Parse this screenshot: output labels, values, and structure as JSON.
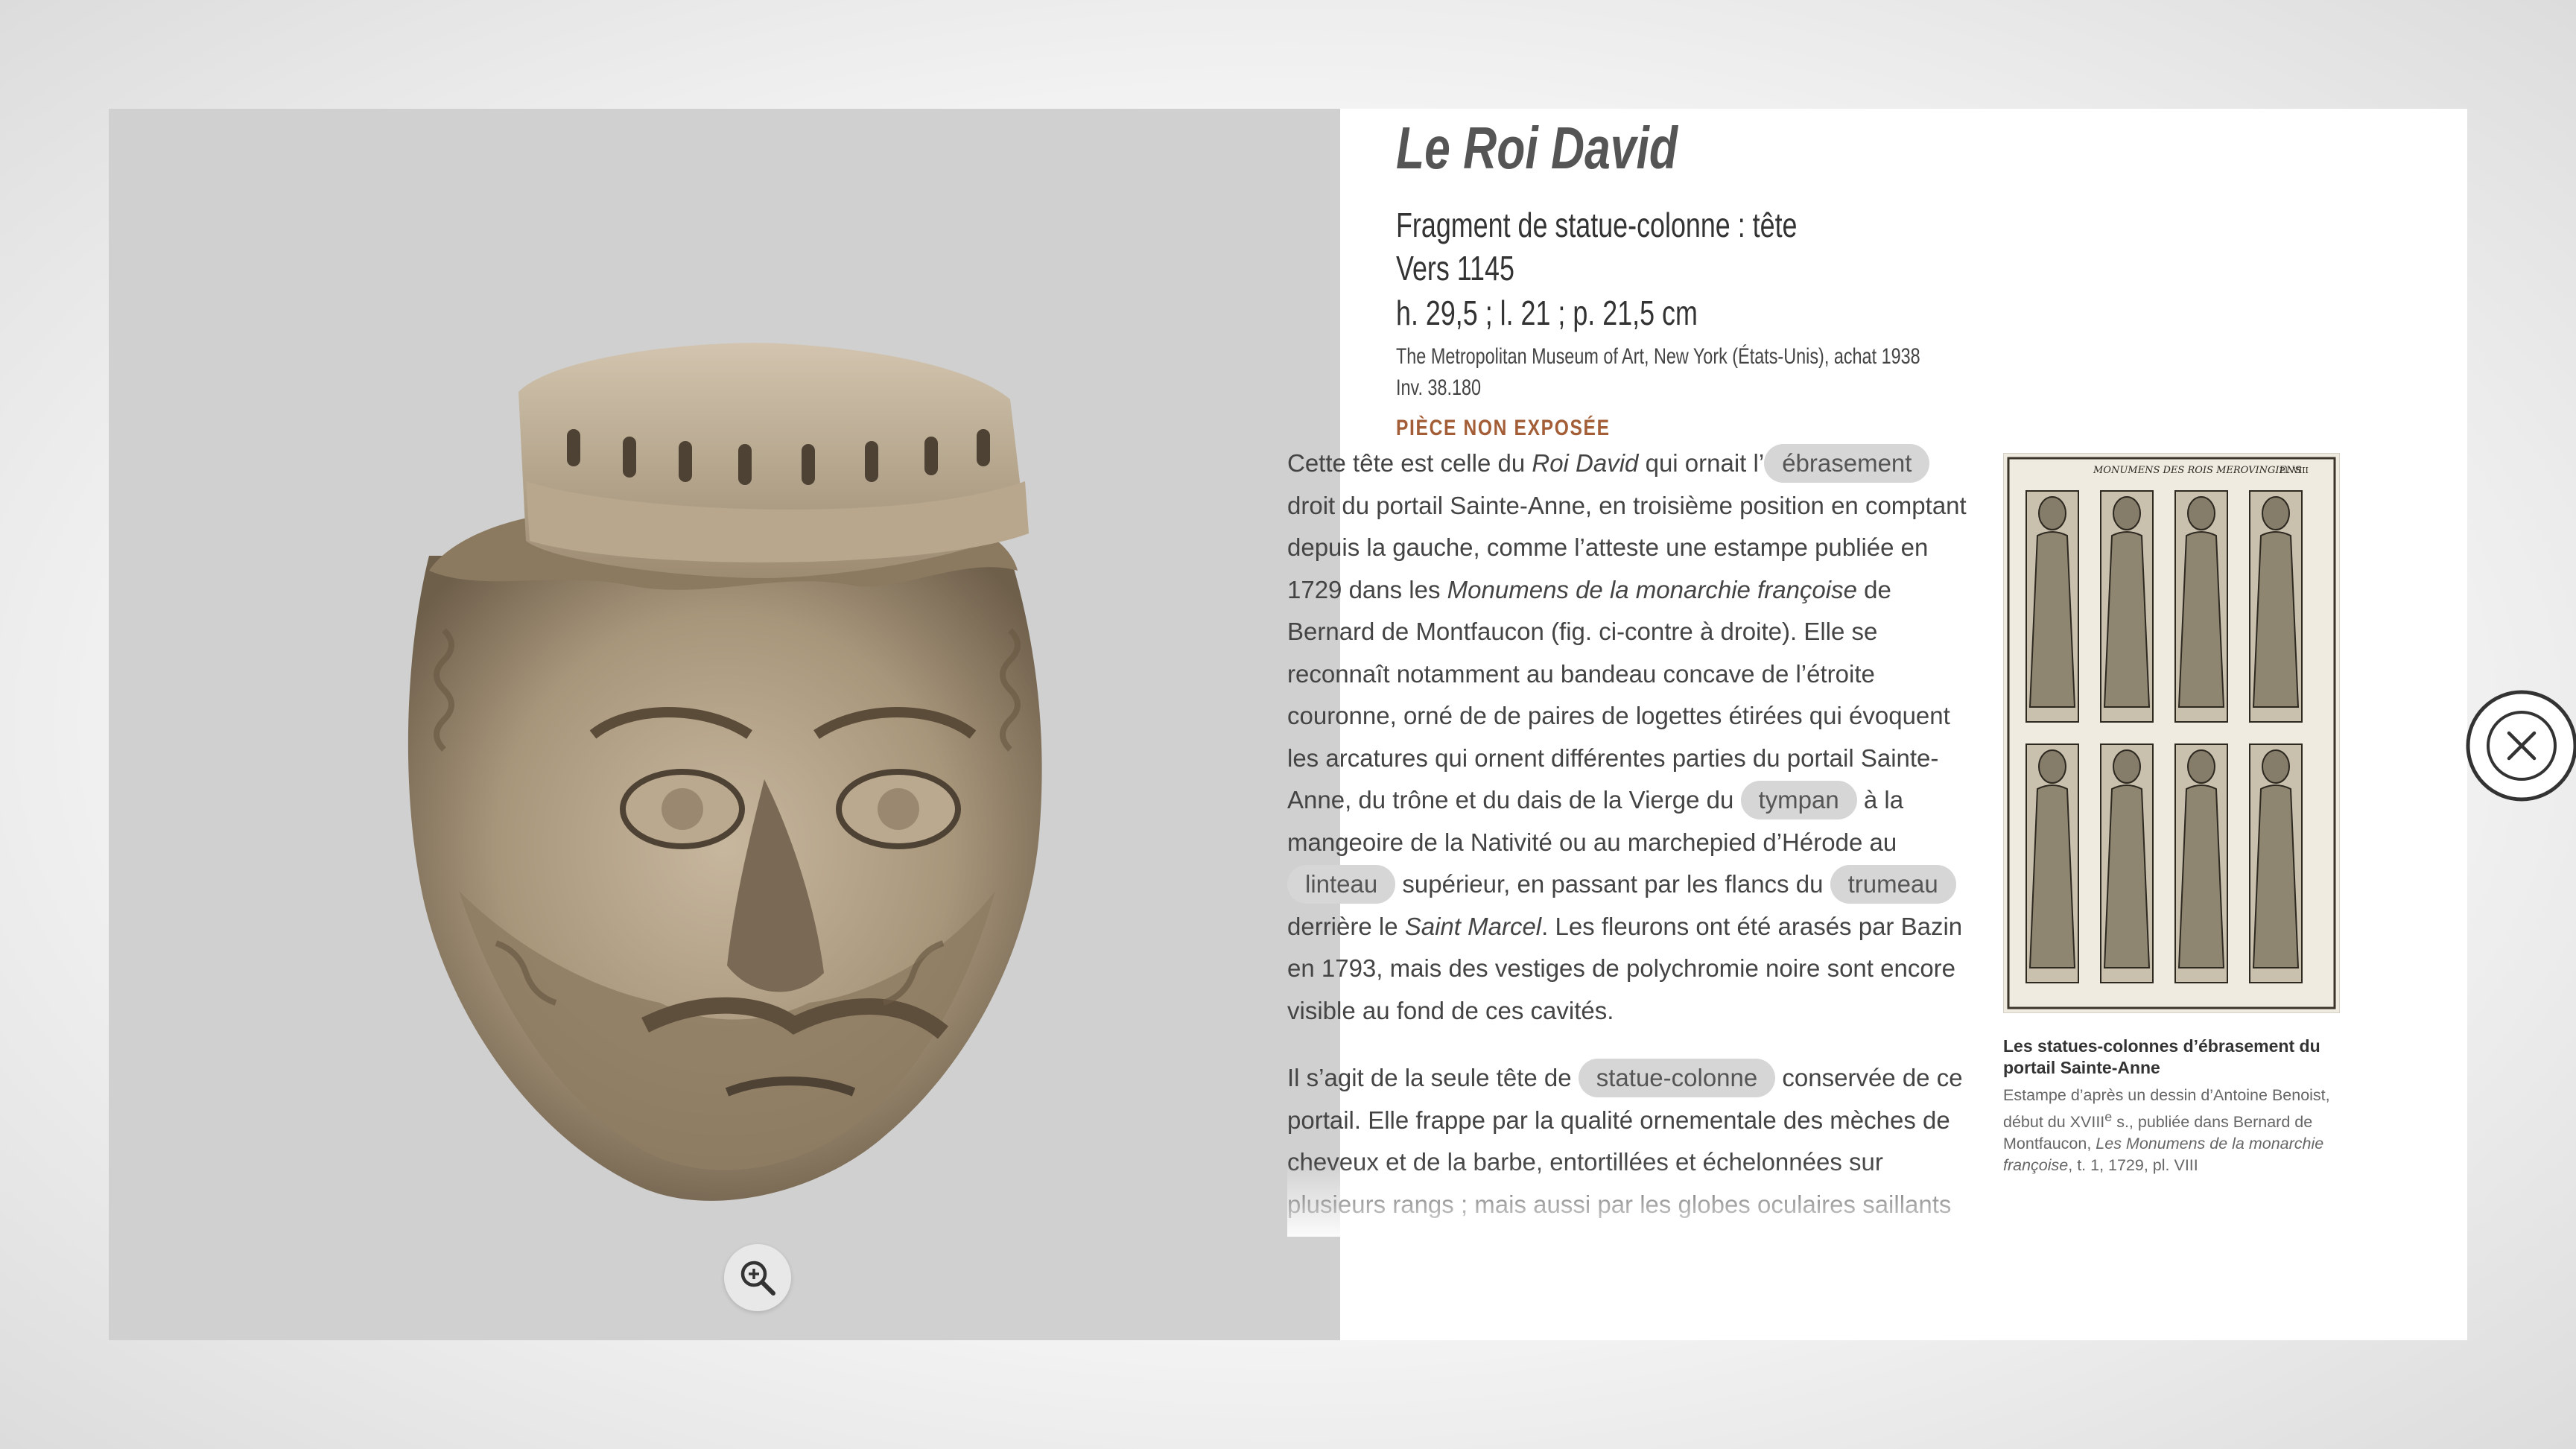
{
  "artwork": {
    "title": "Le Roi David",
    "type": "Fragment de statue-colonne : tête",
    "date": "Vers 1145",
    "dimensions": "h. 29,5 ; l. 21 ; p. 21,5 cm",
    "location": "The Metropolitan Museum of Art, New York (États-Unis), achat 1938",
    "inventory": "Inv. 38.180",
    "status": "PIÈCE NON EXPOSÉE"
  },
  "image": {
    "icon": "sculpture-head-image",
    "zoom_icon": "zoom-in-icon"
  },
  "description": {
    "p1": {
      "t1": "Cette tête est celle du ",
      "em1": "Roi David",
      "t2": " qui ornait l’",
      "pill1": "ébrasement",
      "t3": " droit du portail Sainte-Anne, en troisième position en comptant depuis la gauche, comme l’atteste une estampe publiée en 1729 dans les ",
      "em2": "Monumens de la monarchie françoise",
      "t4": " de Bernard de Montfaucon (fig. ci-contre à droite). Elle se reconnaît notamment au bandeau concave de l’étroite couronne, orné de de paires de logettes étirées qui évoquent les arcatures qui ornent différentes parties du portail Sainte-Anne, du trône et du dais de la Vierge du ",
      "pill2": "tympan",
      "t5": " à la mangeoire de la Nativité ou au marchepied d’Hérode au ",
      "pill3": "linteau",
      "t6": " supérieur, en passant par les flancs du ",
      "pill4": "trumeau",
      "t7": " derrière le ",
      "em3": "Saint Marcel",
      "t8": ". Les fleurons ont été arasés par Bazin en 1793, mais des vestiges de polychromie noire sont encore visible au fond de ces cavités."
    },
    "p2": {
      "t1": "Il s’agit de la seule tête de ",
      "pill1": "statue-colonne",
      "t2": " conservée de ce portail. Elle frappe par la qualité ornementale des mèches de cheveux et de la barbe, entortillées et échelonnées sur plusieurs rangs ; mais aussi par les globes oculaires saillants"
    }
  },
  "figure": {
    "header_left": "MONUMENS DES ROIS MEROVINGIENS",
    "header_right": "Pl. VIII",
    "caption_title": "Les statues-colonnes d’ébrasement du portail Sainte-Anne",
    "caption_t1": "Estampe d’après un dessin d’Antoine Benoist, début du XVIII",
    "caption_sup": "e",
    "caption_t2": " s., publiée dans Bernard de Montfaucon, ",
    "caption_em": "Les Monumens de la monarchie françoise",
    "caption_t3": ", t. 1, 1729, pl. VIII"
  },
  "controls": {
    "close_icon": "close-icon"
  },
  "colors": {
    "accent": "#a35e37",
    "pill_bg": "#d6d6d6",
    "image_bg": "#d0d0d0"
  }
}
